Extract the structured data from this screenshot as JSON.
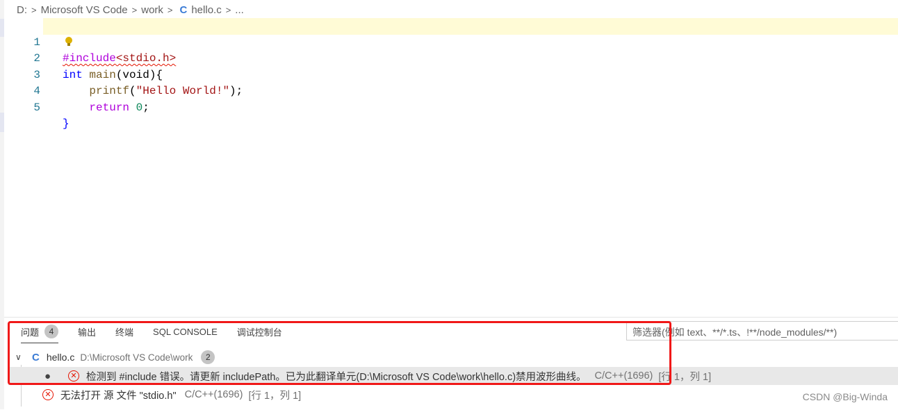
{
  "breadcrumb": {
    "drive": "D:",
    "folder1": "Microsoft VS Code",
    "folder2": "work",
    "file_icon": "C",
    "file": "hello.c",
    "ellipsis": "..."
  },
  "editor": {
    "lines": [
      {
        "num": "1",
        "include": "#include",
        "header": "<stdio.h>"
      },
      {
        "num": "2",
        "type": "int",
        "func": "main",
        "rest": "(void){"
      },
      {
        "num": "3",
        "indent": "    ",
        "call": "printf",
        "open": "(",
        "str": "\"Hello World!\"",
        "close": ");"
      },
      {
        "num": "4",
        "indent": "    ",
        "ret": "return",
        "space": " ",
        "val": "0",
        "semi": ";"
      },
      {
        "num": "5",
        "brace": "}"
      }
    ]
  },
  "panel": {
    "tabs": [
      {
        "label": "问题",
        "badge": "4"
      },
      {
        "label": "输出"
      },
      {
        "label": "终端"
      },
      {
        "label": "SQL CONSOLE"
      },
      {
        "label": "调试控制台"
      }
    ],
    "filter_placeholder": "筛选器(例如 text、**/*.ts、!**/node_modules/**)",
    "file_group": {
      "icon": "C",
      "name": "hello.c",
      "path": "D:\\Microsoft VS Code\\work",
      "count": "2"
    },
    "problems": [
      {
        "message": "检测到 #include 错误。请更新 includePath。已为此翻译单元(D:\\Microsoft VS Code\\work\\hello.c)禁用波形曲线。",
        "source": "C/C++(1696)",
        "position": "[行 1，列 1]"
      },
      {
        "message": "无法打开 源 文件 \"stdio.h\"",
        "source": "C/C++(1696)",
        "position": "[行 1，列 1]"
      }
    ]
  },
  "watermark": "CSDN @Big-Winda",
  "colors": {
    "error": "#e51400",
    "annotation_box": "#f01818",
    "current_line": "#fffbd6"
  }
}
